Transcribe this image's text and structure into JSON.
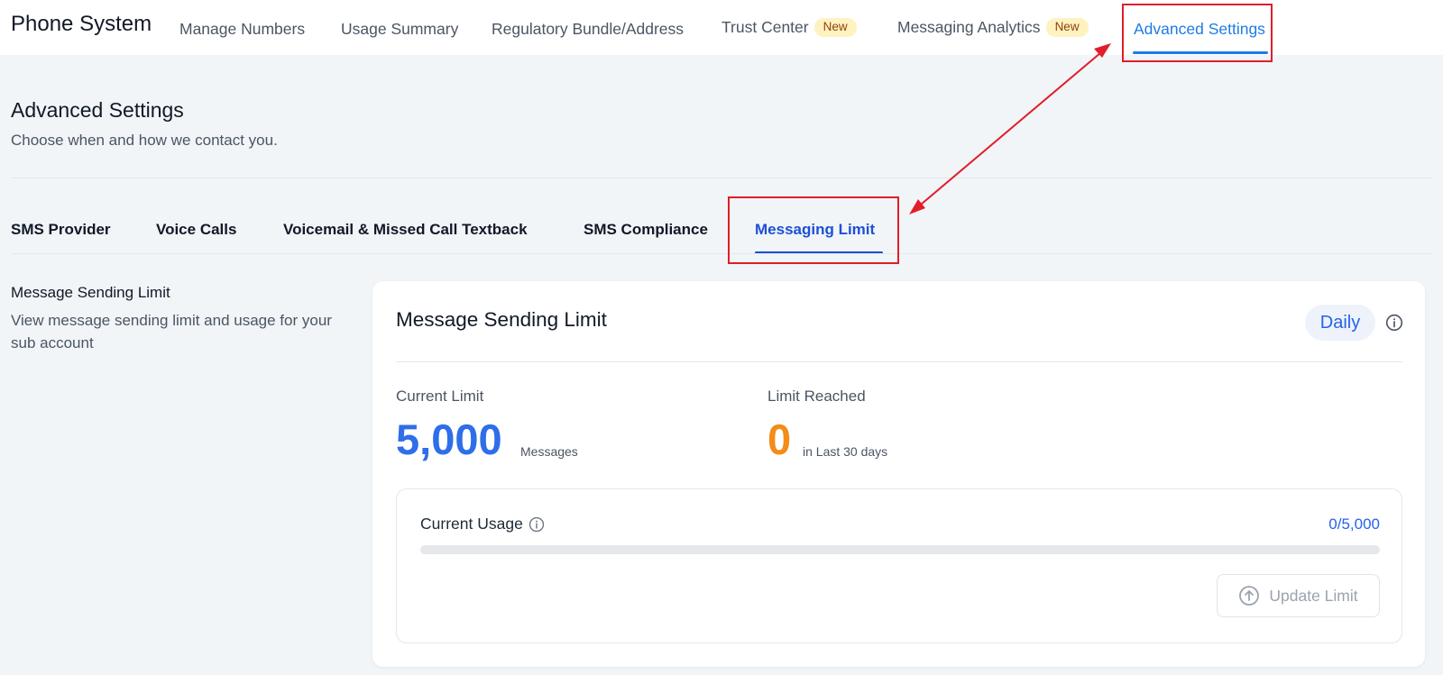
{
  "topnav": {
    "app_title": "Phone System",
    "items": [
      {
        "label": "Manage Numbers"
      },
      {
        "label": "Usage Summary"
      },
      {
        "label": "Regulatory Bundle/Address"
      },
      {
        "label": "Trust Center",
        "badge": "New"
      },
      {
        "label": "Messaging Analytics",
        "badge": "New"
      },
      {
        "label": "Advanced Settings",
        "active": true
      }
    ]
  },
  "page": {
    "title": "Advanced Settings",
    "subtitle": "Choose when and how we contact you."
  },
  "subtabs": [
    {
      "label": "SMS Provider"
    },
    {
      "label": "Voice Calls"
    },
    {
      "label": "Voicemail & Missed Call Textback"
    },
    {
      "label": "SMS Compliance"
    },
    {
      "label": "Messaging Limit",
      "active": true
    }
  ],
  "section": {
    "title": "Message Sending Limit",
    "description": "View message sending limit and usage for your sub account"
  },
  "card": {
    "title": "Message Sending Limit",
    "period": "Daily",
    "current_limit": {
      "label": "Current Limit",
      "value": "5,000",
      "unit": "Messages"
    },
    "limit_reached": {
      "label": "Limit Reached",
      "value": "0",
      "unit": "in Last 30 days"
    },
    "usage": {
      "label": "Current Usage",
      "count": "0/5,000",
      "progress_fraction": 0
    },
    "update_button": "Update Limit"
  },
  "colors": {
    "accent": "#1e7be8",
    "tab_active": "#1d4fd8",
    "limit_value": "#2e6ee8",
    "reached_value": "#f28c1b",
    "annotation": "#e11d2a"
  },
  "icons": [
    "info-icon",
    "arrow-up-circle-icon"
  ]
}
